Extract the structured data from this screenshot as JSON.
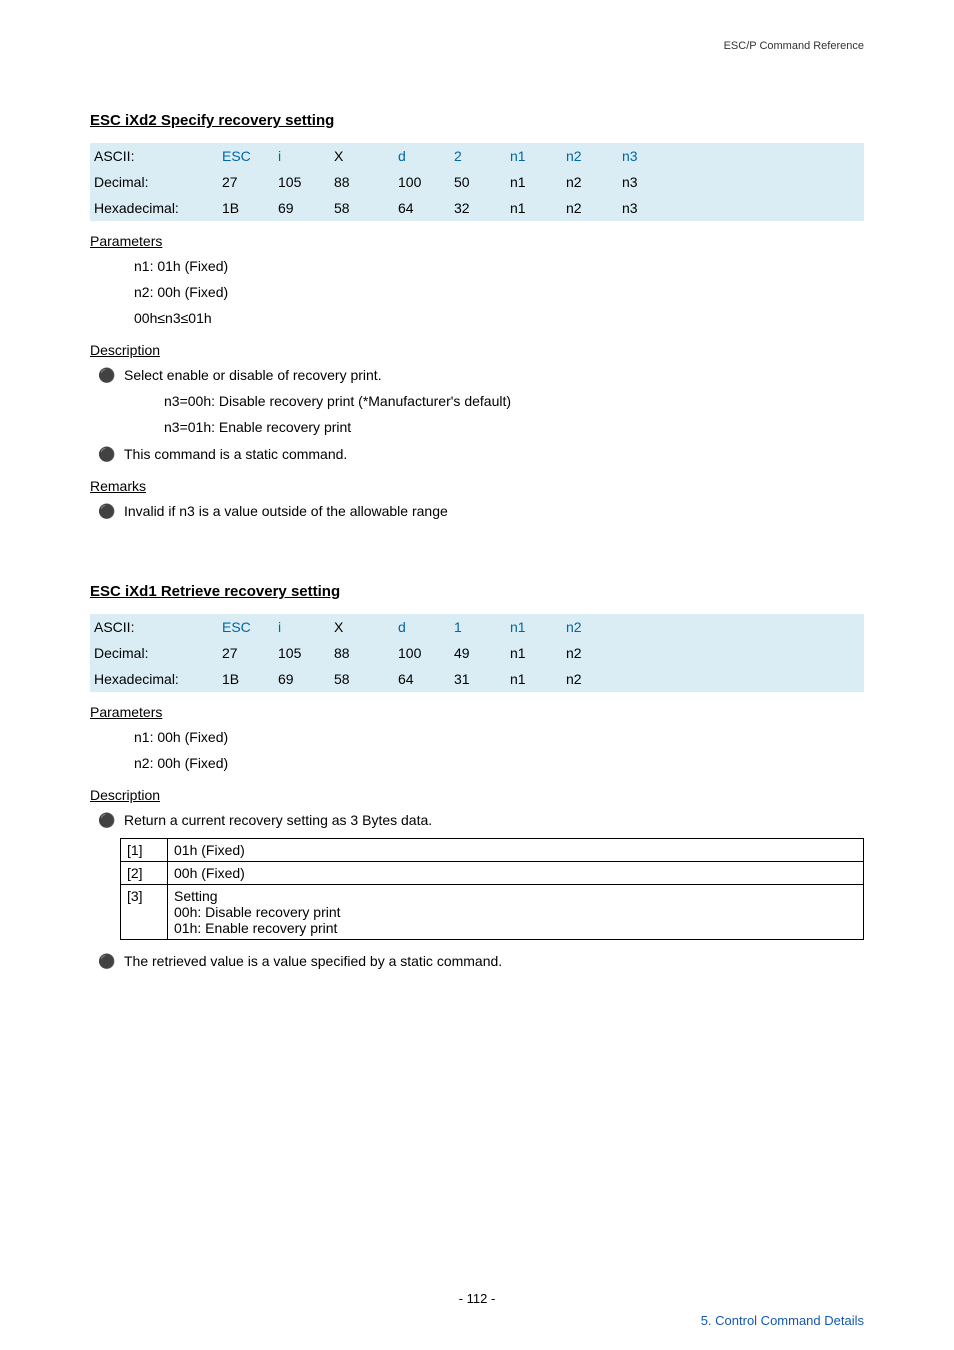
{
  "header_right": "ESC/P Command Reference",
  "section1": {
    "title": "ESC iXd2   Specify recovery setting",
    "table": {
      "rows": [
        {
          "label": "ASCII:",
          "c": [
            "ESC",
            "i",
            "X",
            "d",
            "2",
            "n1",
            "n2",
            "n3"
          ]
        },
        {
          "label": "Decimal:",
          "c": [
            "27",
            "105",
            "88",
            "100",
            "50",
            "n1",
            "n2",
            "n3"
          ]
        },
        {
          "label": "Hexadecimal:",
          "c": [
            "1B",
            "69",
            "58",
            "64",
            "32",
            "n1",
            "n2",
            "n3"
          ]
        }
      ]
    },
    "parameters_head": "Parameters",
    "parameters": [
      "n1: 01h (Fixed)",
      "n2: 00h (Fixed)",
      "00h≤n3≤01h"
    ],
    "description_head": "Description",
    "desc_b1": "Select enable or disable of recovery print.",
    "desc_b1_sub": [
      "n3=00h:   Disable recovery print (*Manufacturer's default)",
      "n3=01h:   Enable recovery print"
    ],
    "desc_b2": "This command is a static command.",
    "remarks_head": "Remarks",
    "remarks_b1": "Invalid if n3 is a value outside of the allowable range"
  },
  "section2": {
    "title": "ESC iXd1   Retrieve recovery setting",
    "table": {
      "rows": [
        {
          "label": "ASCII:",
          "c": [
            "ESC",
            "i",
            "X",
            "d",
            "1",
            "n1",
            "n2"
          ]
        },
        {
          "label": "Decimal:",
          "c": [
            "27",
            "105",
            "88",
            "100",
            "49",
            "n1",
            "n2"
          ]
        },
        {
          "label": "Hexadecimal:",
          "c": [
            "1B",
            "69",
            "58",
            "64",
            "31",
            "n1",
            "n2"
          ]
        }
      ]
    },
    "parameters_head": "Parameters",
    "parameters": [
      "n1: 00h (Fixed)",
      "n2: 00h (Fixed)"
    ],
    "description_head": "Description",
    "desc_b1": "Return a current recovery setting as 3 Bytes data.",
    "bytes_table": [
      {
        "idx": "[1]",
        "val": "01h (Fixed)"
      },
      {
        "idx": "[2]",
        "val": "00h (Fixed)"
      },
      {
        "idx": "[3]",
        "val": "Setting\n00h: Disable recovery print\n01h: Enable recovery print"
      }
    ],
    "desc_b2": "The retrieved value is a value specified by a static command."
  },
  "footer_center": "- 112 -",
  "footer_right": "5. Control Command Details"
}
